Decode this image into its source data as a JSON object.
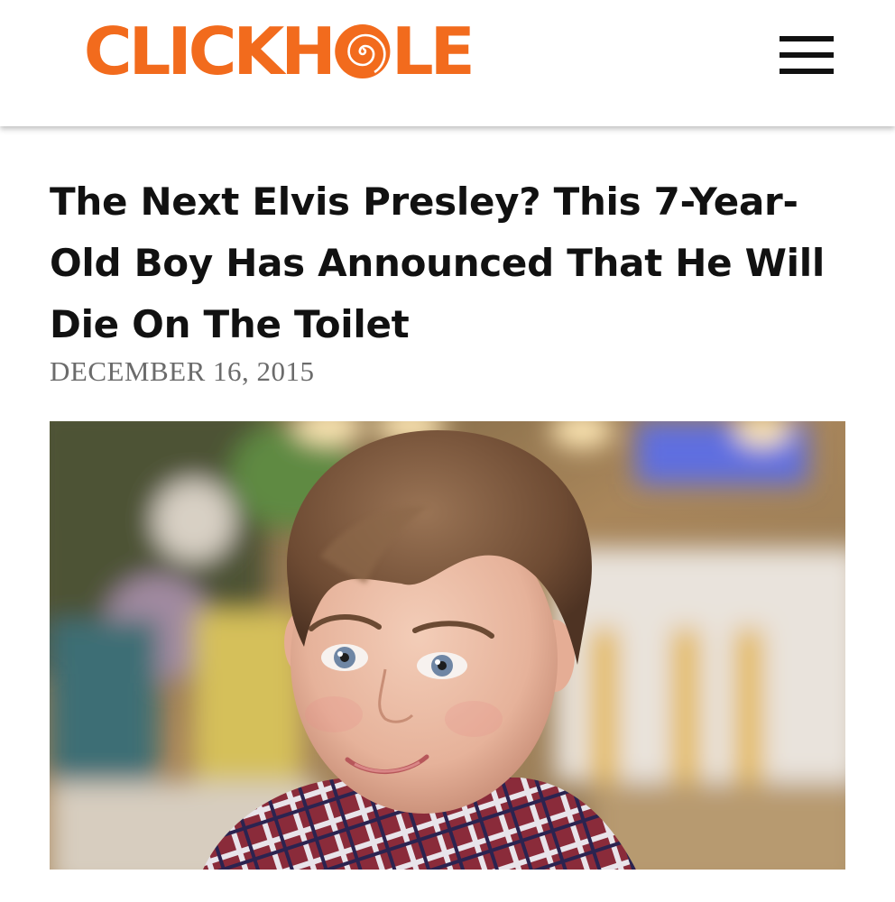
{
  "header": {
    "logo_text_left": "CLICKH",
    "logo_text_right": "LE",
    "logo_label": "CLICKHOLE",
    "brand_color": "#f26b1d",
    "menu_icon": "hamburger-menu-icon"
  },
  "article": {
    "title": "The Next Elvis Presley? This 7-Year-Old Boy Has Announced That He Will Die On The Toilet",
    "date": "DECEMBER 16, 2015",
    "hero_image": "photo of smiling boy with brown hair and plaid shirt in a blurred cafe"
  }
}
